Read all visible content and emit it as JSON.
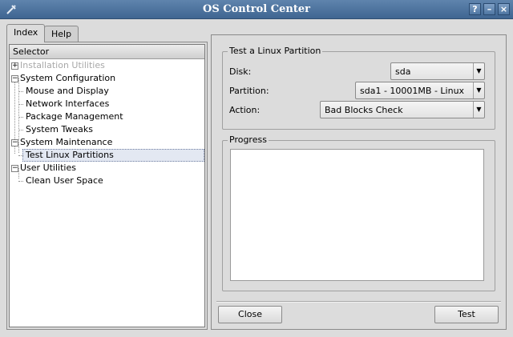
{
  "window": {
    "title": "OS Control Center",
    "controls": [
      {
        "name": "help",
        "glyph": "?"
      },
      {
        "name": "minimize",
        "glyph": "–"
      },
      {
        "name": "close",
        "glyph": "×"
      }
    ]
  },
  "tabs": [
    {
      "label": "Index",
      "active": true
    },
    {
      "label": "Help",
      "active": false
    }
  ],
  "tree": {
    "header": "Selector",
    "items": [
      {
        "label": "Installation Utilities",
        "level": 0,
        "expander": "+",
        "disabled": true
      },
      {
        "label": "System Configuration",
        "level": 0,
        "expander": "−"
      },
      {
        "label": "Mouse and Display",
        "level": 1
      },
      {
        "label": "Network Interfaces",
        "level": 1
      },
      {
        "label": "Package Management",
        "level": 1
      },
      {
        "label": "System Tweaks",
        "level": 1
      },
      {
        "label": "System Maintenance",
        "level": 0,
        "expander": "−"
      },
      {
        "label": "Test Linux Partitions",
        "level": 1,
        "selected": true
      },
      {
        "label": "User Utilities",
        "level": 0,
        "expander": "−"
      },
      {
        "label": "Clean User Space",
        "level": 1
      }
    ]
  },
  "test_group": {
    "title": "Test a Linux Partition",
    "disk_label": "Disk:",
    "disk_value": "sda",
    "partition_label": "Partition:",
    "partition_value": "sda1 - 10001MB - Linux",
    "action_label": "Action:",
    "action_value": "Bad Blocks Check"
  },
  "progress_group": {
    "title": "Progress"
  },
  "buttons": {
    "close": "Close",
    "test": "Test"
  }
}
